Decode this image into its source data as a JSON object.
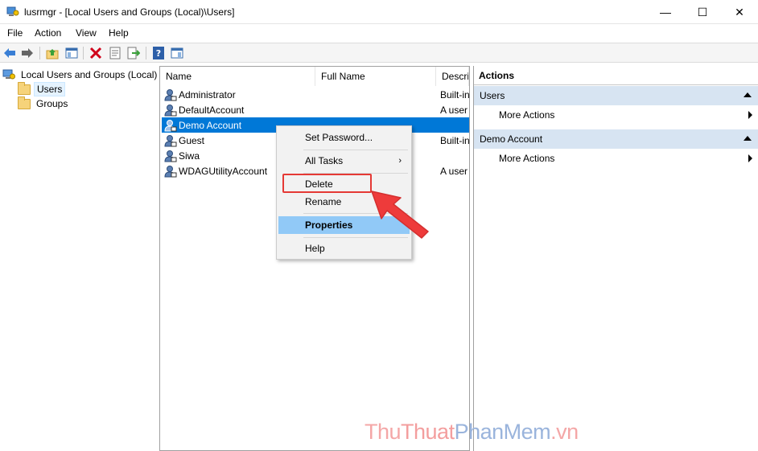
{
  "window": {
    "title": "lusrmgr - [Local Users and Groups (Local)\\Users]",
    "minimize": "—",
    "maximize": "☐",
    "close": "✕"
  },
  "menu": [
    "File",
    "Action",
    "View",
    "Help"
  ],
  "toolbar": {
    "icons": [
      "back-arrow-icon",
      "forward-arrow-icon",
      "up-folder-icon",
      "show-hide-tree-icon",
      "delete-icon",
      "properties-icon",
      "export-list-icon",
      "help-icon",
      "show-action-pane-icon"
    ]
  },
  "tree": {
    "root": "Local Users and Groups (Local)",
    "items": [
      "Users",
      "Groups"
    ],
    "selected": "Users"
  },
  "list": {
    "columns": [
      "Name",
      "Full Name",
      "Descri"
    ],
    "rows": [
      {
        "name": "Administrator",
        "full_name": "",
        "desc": "Built-in"
      },
      {
        "name": "DefaultAccount",
        "full_name": "",
        "desc": "A user"
      },
      {
        "name": "Demo Account",
        "full_name": "",
        "desc": ""
      },
      {
        "name": "Guest",
        "full_name": "",
        "desc": "Built-in"
      },
      {
        "name": "Siwa",
        "full_name": "",
        "desc": ""
      },
      {
        "name": "WDAGUtilityAccount",
        "full_name": "",
        "desc": "A user"
      }
    ],
    "selected": "Demo Account"
  },
  "context_menu": {
    "set_password": "Set Password...",
    "all_tasks": "All Tasks",
    "delete": "Delete",
    "rename": "Rename",
    "properties": "Properties",
    "help": "Help",
    "submenu_arrow": "›"
  },
  "actions": {
    "title": "Actions",
    "groups": [
      {
        "name": "Users",
        "link": "More Actions"
      },
      {
        "name": "Demo Account",
        "link": "More Actions"
      }
    ]
  },
  "watermark": {
    "part1": "Thu",
    "part2": "Thuat",
    "part3": "PhanMem",
    "part4": ".vn"
  },
  "colors": {
    "selection": "#0078d7",
    "menu_highlight": "#91c9f7",
    "action_group": "#d7e4f2",
    "callout_red": "#e53935"
  }
}
